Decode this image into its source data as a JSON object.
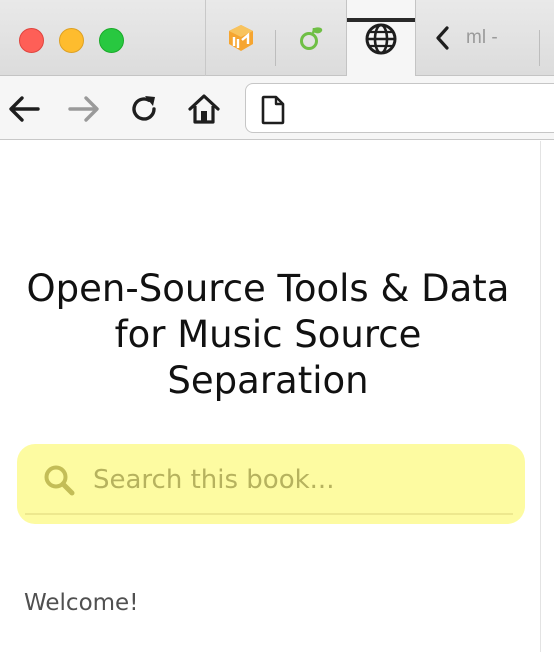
{
  "window": {
    "traffic_lights": {
      "close": "#fe5f57",
      "minimize": "#febc2e",
      "zoom": "#28c840"
    }
  },
  "tabs": [
    {
      "icon": "book-logo-icon",
      "active": false
    },
    {
      "icon": "leaf-logo-icon",
      "active": false
    },
    {
      "icon": "globe-icon",
      "active": true
    },
    {
      "icon": "chevron-left-icon",
      "label": "ml -",
      "active": false
    }
  ],
  "toolbar": {
    "back_icon": "arrow-left-icon",
    "forward_icon": "arrow-right-icon",
    "reload_icon": "reload-icon",
    "home_icon": "home-icon",
    "address_value": ""
  },
  "page": {
    "title": "Open-Source Tools & Data for Music Source Separation",
    "search": {
      "placeholder": "Search this book...",
      "value": "",
      "background": "#fdfba1"
    },
    "nav_first_item": "Welcome!"
  }
}
